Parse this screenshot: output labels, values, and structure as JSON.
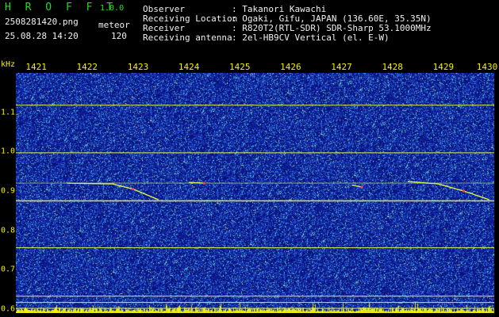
{
  "app": {
    "name": "H R O F F T",
    "version": "1.0.0"
  },
  "file": {
    "name": "2508281420.png",
    "datetime": "25.08.28 14:20"
  },
  "mode": {
    "label": "meteor",
    "count": "120"
  },
  "info": {
    "rows": [
      {
        "label": "Observer",
        "value": ": Takanori Kawachi"
      },
      {
        "label": "Receiving Location",
        "value": ": Ogaki, Gifu, JAPAN (136.60E, 35.35N)"
      },
      {
        "label": "Receiver",
        "value": ": R820T2(RTL-SDR) SDR-Sharp 53.1000MHz"
      },
      {
        "label": "Receiving antenna",
        "value": ": 2el-HB9CV Vertical (el. E-W)"
      }
    ]
  },
  "chart_data": {
    "type": "heatmap",
    "x_ticks": [
      "1421",
      "1422",
      "1423",
      "1424",
      "1425",
      "1426",
      "1427",
      "1428",
      "1429",
      "1430"
    ],
    "y_unit": "kHz",
    "y_ticks": [
      "1.1",
      "1.0",
      "0.9",
      "0.8",
      "0.7",
      "0.6"
    ],
    "y_tick_values": [
      1.1,
      1.0,
      0.9,
      0.8,
      0.7,
      0.6
    ],
    "ylim": [
      0.59,
      1.2
    ],
    "horizontal_signals_khz": [
      1.118,
      0.997,
      0.92,
      0.875,
      0.756,
      0.633,
      0.617,
      0.602
    ],
    "meteor_traces": [
      {
        "x": [
          1421.6,
          1422.5,
          1422.9,
          1423.4
        ],
        "y_khz": [
          0.92,
          0.918,
          0.905,
          0.878
        ]
      },
      {
        "x": [
          1424.0,
          1424.3
        ],
        "y_khz": [
          0.922,
          0.92
        ]
      },
      {
        "x": [
          1427.2,
          1427.4
        ],
        "y_khz": [
          0.915,
          0.91
        ]
      },
      {
        "x": [
          1428.3,
          1428.9,
          1429.4,
          1429.9
        ],
        "y_khz": [
          0.924,
          0.918,
          0.9,
          0.878
        ]
      }
    ],
    "colors": {
      "background": "#0a1480",
      "signal": "#d8ee50",
      "axis_text": "#f4f000",
      "strong": "#ff4040"
    }
  }
}
